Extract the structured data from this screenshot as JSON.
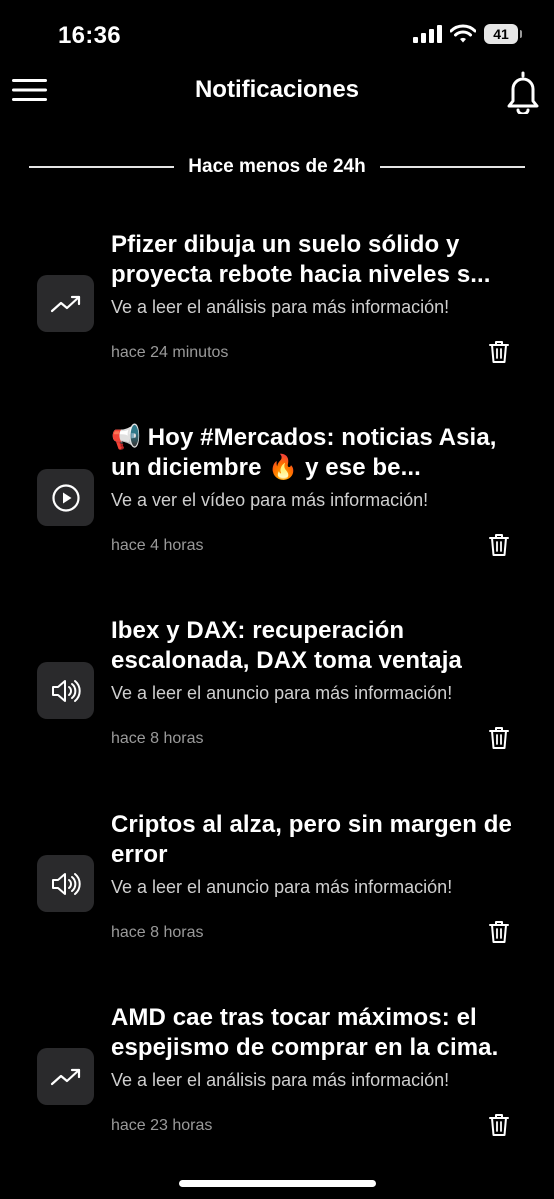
{
  "status": {
    "time": "16:36",
    "battery": "41",
    "icons": [
      "signal-icon",
      "wifi-icon",
      "battery-icon"
    ]
  },
  "header": {
    "title": "Notificaciones",
    "menu_icon": "hamburger-menu-icon",
    "bell_icon": "bell-icon"
  },
  "section": {
    "label": "Hace menos de 24h"
  },
  "notifications": [
    {
      "icon": "trending-up-icon",
      "title": "Pfizer dibuja un suelo sólido y proyecta rebote hacia niveles s...",
      "subtitle": "Ve a leer el análisis para más información!",
      "time": "hace 24 minutos"
    },
    {
      "icon": "play-circle-icon",
      "title": "📢 Hoy #Mercados: noticias Asia, un diciembre 🔥 y ese be...",
      "subtitle": "Ve a ver el vídeo para más información!",
      "time": "hace 4 horas"
    },
    {
      "icon": "speaker-icon",
      "title": "Ibex y DAX: recuperación escalonada, DAX toma ventaja",
      "subtitle": "Ve a leer el anuncio para más información!",
      "time": "hace 8 horas"
    },
    {
      "icon": "speaker-icon",
      "title": "Criptos al alza, pero sin margen de error",
      "subtitle": "Ve a leer el anuncio para más información!",
      "time": "hace 8 horas"
    },
    {
      "icon": "trending-up-icon",
      "title": "AMD cae tras tocar máximos: el espejismo de comprar en la cima.",
      "subtitle": "Ve a leer el análisis para más información!",
      "time": "hace 23 horas"
    }
  ],
  "colors": {
    "background": "#000000",
    "text": "#ffffff",
    "subtitle": "#cfcfcf",
    "timestamp": "#9a9a9a",
    "icon_box": "#2a2a2c"
  }
}
